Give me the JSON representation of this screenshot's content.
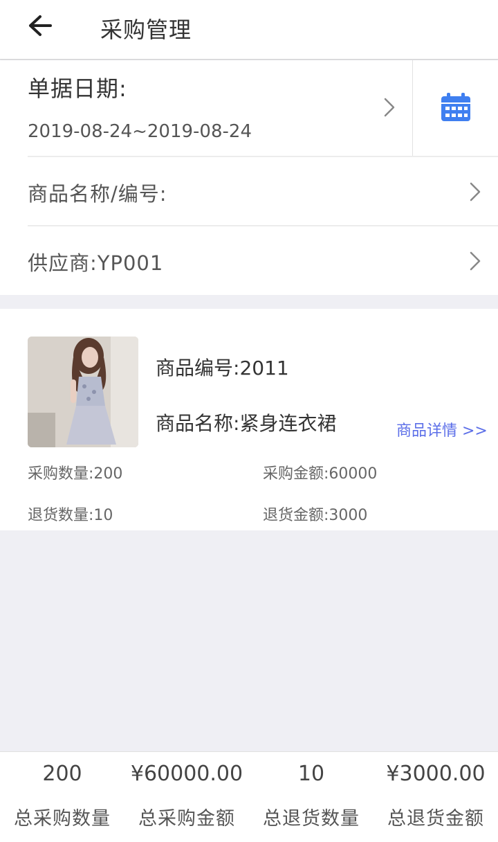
{
  "header": {
    "title": "采购管理",
    "back_icon": "arrow-left-icon"
  },
  "filters": {
    "date_label": "单据日期:",
    "date_range": "2019-08-24~2019-08-24",
    "calendar_icon": "calendar-icon",
    "calendar_color": "#3f7ff0",
    "product_label": "商品名称/编号:",
    "supplier_label": "供应商:",
    "supplier_value": "YP001"
  },
  "product": {
    "code_label": "商品编号:",
    "code_value": "2011",
    "name_label": "商品名称:",
    "name_value": "紧身连衣裙",
    "detail_link": "商品详情 >>",
    "purchase_qty_label": "采购数量:",
    "purchase_qty": "200",
    "purchase_amount_label": "采购金额:",
    "purchase_amount": "60000",
    "return_qty_label": "退货数量:",
    "return_qty": "10",
    "return_amount_label": "退货金额:",
    "return_amount": "3000"
  },
  "summary": [
    {
      "value": "200",
      "label": "总采购数量"
    },
    {
      "value": "¥60000.00",
      "label": "总采购金额"
    },
    {
      "value": "10",
      "label": "总退货数量"
    },
    {
      "value": "¥3000.00",
      "label": "总退货金额"
    }
  ],
  "colors": {
    "accent": "#5b6ee8",
    "background": "#efeff4"
  }
}
